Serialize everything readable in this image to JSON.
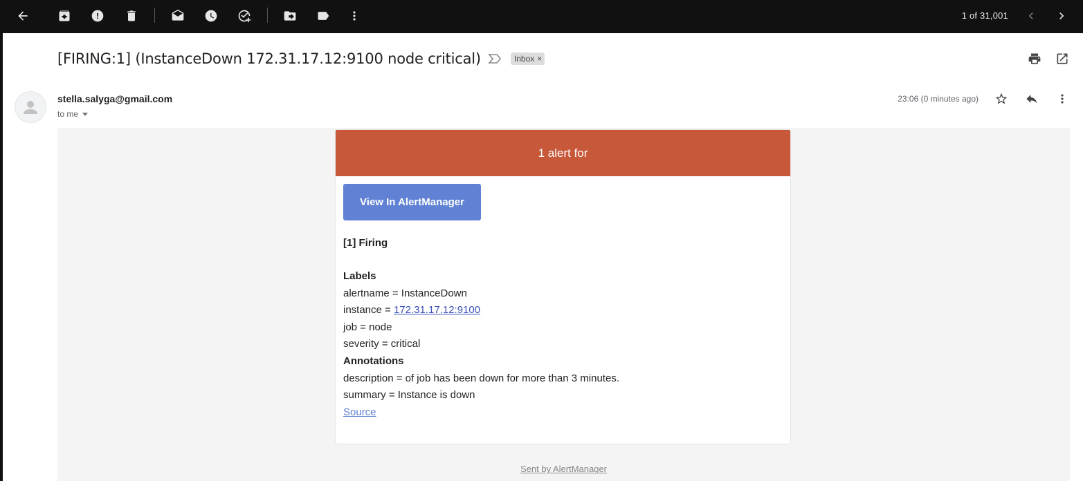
{
  "toolbar": {
    "icons": [
      "back-arrow-icon",
      "archive-icon",
      "report-spam-icon",
      "delete-icon",
      "mark-unread-icon",
      "snooze-icon",
      "add-to-tasks-icon",
      "move-to-icon",
      "labels-icon",
      "more-vert-icon"
    ],
    "pager_text": "1 of 31,001"
  },
  "email": {
    "subject": "[FIRING:1] (InstanceDown 172.31.17.12:9100 node critical)",
    "label_chip": "Inbox",
    "label_chip_close": "×",
    "sender": "stella.salyga@gmail.com",
    "to_me": "to me",
    "timestamp": "23:06 (0 minutes ago)"
  },
  "alert": {
    "header_text": "1 alert for",
    "header_color": "#c7583a",
    "button_label": "View In AlertManager",
    "button_color": "#6182d4",
    "firing_heading": "[1] Firing",
    "labels_heading": "Labels",
    "labels": {
      "alertname": "alertname = InstanceDown",
      "instance_prefix": "instance = ",
      "instance_link": "172.31.17.12:9100",
      "job": "job = node",
      "severity": "severity = critical"
    },
    "annotations_heading": "Annotations",
    "annotations": {
      "description": "description = of job has been down for more than 3 minutes.",
      "summary": "summary = Instance is down"
    },
    "source_link": "Source"
  },
  "footer": {
    "sent_by": "Sent by AlertManager"
  }
}
